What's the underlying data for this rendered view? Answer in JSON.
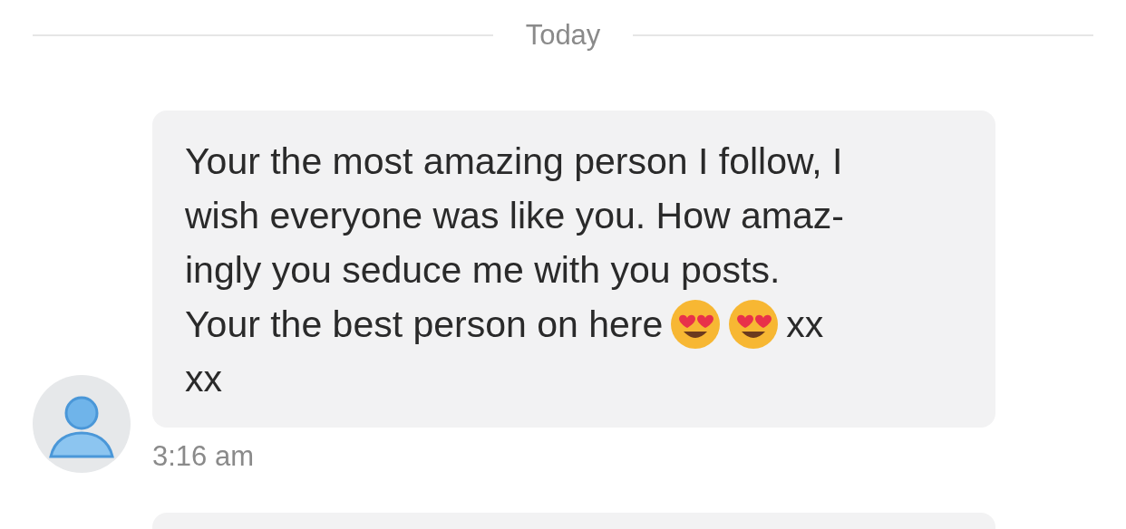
{
  "date_divider": "Today",
  "messages": [
    {
      "avatar": true,
      "lines": [
        {
          "text": "Your the most amazing person I follow, I"
        },
        {
          "text": "wish everyone was like you. How amaz-"
        },
        {
          "text": "ingly you seduce me with you posts."
        },
        {
          "text": "Your the best person on here",
          "emojis": [
            {
              "kind": "heart-eyes"
            },
            {
              "kind": "heart-eyes"
            }
          ],
          "tail": "xx"
        },
        {
          "text": "xx"
        }
      ],
      "time": "3:16 am"
    },
    {
      "avatar": false
    }
  ]
}
